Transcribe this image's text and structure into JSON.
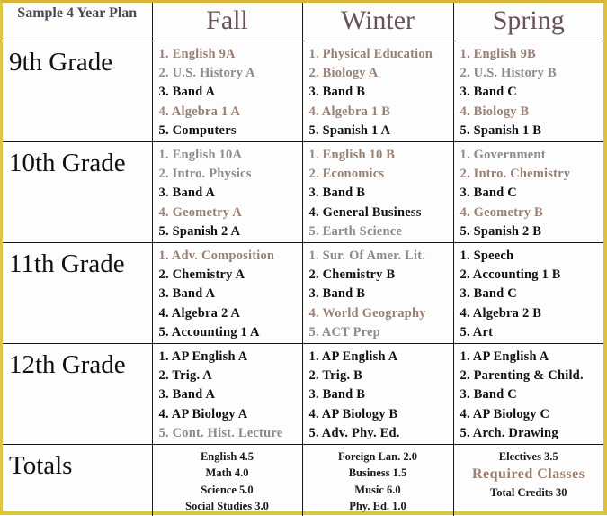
{
  "title": "Sample 4 Year Plan",
  "terms": [
    "Fall",
    "Winter",
    "Spring"
  ],
  "legend_colors": {
    "required": "#111111",
    "elective": "#9a8074",
    "border": "#d8b53a"
  },
  "grades": [
    {
      "label": "9th Grade",
      "terms": [
        [
          {
            "text": "1. English 9A",
            "style": "elec"
          },
          {
            "text": "2. U.S. History A",
            "style": "elec-gray"
          },
          {
            "text": "3. Band A",
            "style": "req"
          },
          {
            "text": "4. Algebra 1 A",
            "style": "elec"
          },
          {
            "text": "5. Computers",
            "style": "req"
          }
        ],
        [
          {
            "text": "1. Physical Education",
            "style": "elec"
          },
          {
            "text": "2. Biology A",
            "style": "elec"
          },
          {
            "text": "3. Band B",
            "style": "req"
          },
          {
            "text": "4. Algebra 1 B",
            "style": "elec"
          },
          {
            "text": "5. Spanish 1 A",
            "style": "req"
          }
        ],
        [
          {
            "text": "1. English 9B",
            "style": "elec"
          },
          {
            "text": "2. U.S. History B",
            "style": "elec-gray"
          },
          {
            "text": "3. Band C",
            "style": "req"
          },
          {
            "text": "4. Biology B",
            "style": "elec"
          },
          {
            "text": "5. Spanish 1 B",
            "style": "req"
          }
        ]
      ]
    },
    {
      "label": "10th Grade",
      "terms": [
        [
          {
            "text": "1. English 10A",
            "style": "elec-gray"
          },
          {
            "text": "2. Intro. Physics",
            "style": "elec-gray"
          },
          {
            "text": "3. Band A",
            "style": "req"
          },
          {
            "text": "4. Geometry A",
            "style": "elec"
          },
          {
            "text": "5. Spanish 2 A",
            "style": "req"
          }
        ],
        [
          {
            "text": "1. English 10 B",
            "style": "elec"
          },
          {
            "text": "2. Economics",
            "style": "elec"
          },
          {
            "text": "3. Band B",
            "style": "req"
          },
          {
            "text": "4. General Business",
            "style": "req"
          },
          {
            "text": "5. Earth Science",
            "style": "elec-gray"
          }
        ],
        [
          {
            "text": "1. Government",
            "style": "elec-gray"
          },
          {
            "text": "2. Intro. Chemistry",
            "style": "elec"
          },
          {
            "text": "3. Band C",
            "style": "req"
          },
          {
            "text": "4. Geometry B",
            "style": "elec"
          },
          {
            "text": "5. Spanish 2 B",
            "style": "req"
          }
        ]
      ]
    },
    {
      "label": "11th Grade",
      "terms": [
        [
          {
            "text": "1. Adv. Composition",
            "style": "elec"
          },
          {
            "text": "2. Chemistry A",
            "style": "req"
          },
          {
            "text": "3. Band A",
            "style": "req"
          },
          {
            "text": "4. Algebra 2 A",
            "style": "req"
          },
          {
            "text": "5. Accounting 1 A",
            "style": "req"
          }
        ],
        [
          {
            "text": "1. Sur. Of Amer. Lit.",
            "style": "elec-gray"
          },
          {
            "text": "2. Chemistry B",
            "style": "req"
          },
          {
            "text": "3. Band B",
            "style": "req"
          },
          {
            "text": "4. World Geography",
            "style": "elec"
          },
          {
            "text": "5. ACT Prep",
            "style": "elec-gray"
          }
        ],
        [
          {
            "text": "1. Speech",
            "style": "req"
          },
          {
            "text": "2. Accounting 1 B",
            "style": "req"
          },
          {
            "text": "3. Band C",
            "style": "req"
          },
          {
            "text": "4. Algebra 2 B",
            "style": "req"
          },
          {
            "text": "5. Art",
            "style": "req"
          }
        ]
      ]
    },
    {
      "label": "12th Grade",
      "terms": [
        [
          {
            "text": "1. AP English A",
            "style": "req"
          },
          {
            "text": "2. Trig.  A",
            "style": "req"
          },
          {
            "text": "3. Band A",
            "style": "req"
          },
          {
            "text": "4. AP Biology A",
            "style": "req"
          },
          {
            "text": "5. Cont. Hist. Lecture",
            "style": "elec-gray"
          }
        ],
        [
          {
            "text": "1. AP English A",
            "style": "req"
          },
          {
            "text": "2. Trig. B",
            "style": "req"
          },
          {
            "text": "3. Band B",
            "style": "req"
          },
          {
            "text": "4. AP Biology B",
            "style": "req"
          },
          {
            "text": "5. Adv. Phy. Ed.",
            "style": "req"
          }
        ],
        [
          {
            "text": "1. AP English A",
            "style": "req"
          },
          {
            "text": "2. Parenting & Child.",
            "style": "req"
          },
          {
            "text": "3. Band C",
            "style": "req"
          },
          {
            "text": "4. AP Biology C",
            "style": "req"
          },
          {
            "text": "5. Arch. Drawing",
            "style": "req"
          }
        ]
      ]
    }
  ],
  "totals": {
    "label": "Totals",
    "fall": [
      "English 4.5",
      "Math 4.0",
      "Science 5.0",
      "Social Studies 3.0"
    ],
    "winter": [
      "Foreign Lan. 2.0",
      "Business 1.5",
      "Music 6.0",
      "Phy. Ed. 1.0"
    ],
    "spring": {
      "electives": "Electives 3.5",
      "required_classes": "Required Classes",
      "total_credits": "Total Credits 30"
    }
  }
}
